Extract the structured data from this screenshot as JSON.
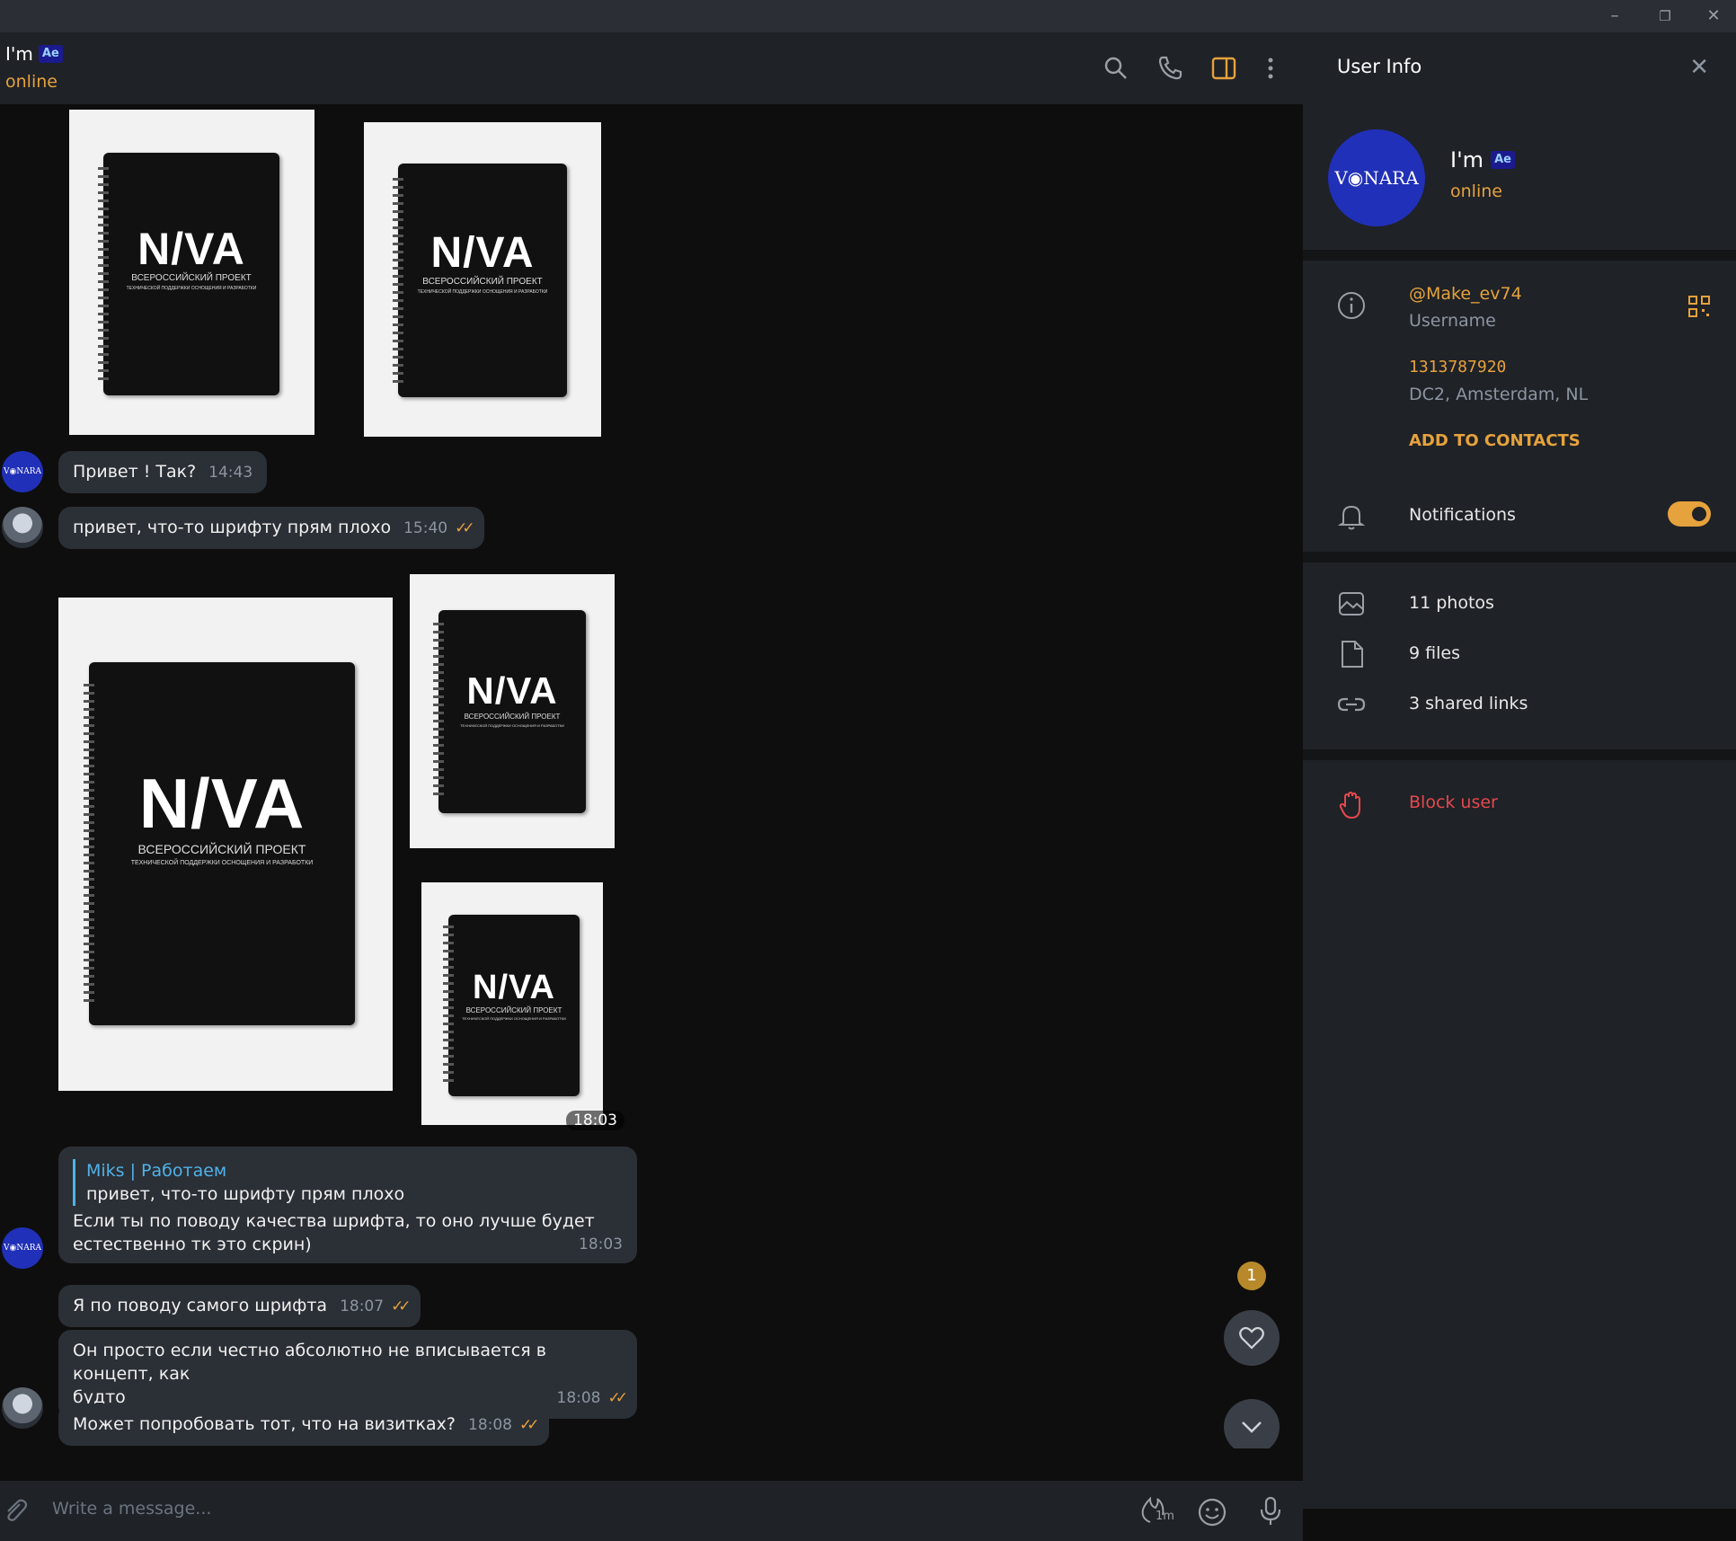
{
  "window": {
    "minimize": "–",
    "restore": "❐",
    "close": "✕"
  },
  "chat_header": {
    "name": "I'm",
    "badge": "Ae",
    "status": "online"
  },
  "messages": {
    "m1": {
      "text": "Привет ! Так?",
      "time": "14:43"
    },
    "m2": {
      "text": "привет, что-то шрифту прям плохо",
      "time": "15:40"
    },
    "album_time": "18:03",
    "m3": {
      "reply_name": "Miks | Работаем",
      "reply_text": "привет, что-то шрифту прям плохо",
      "text_line1": "Если ты по поводу качества шрифта, то оно лучше будет",
      "text_line2": "естественно тк это скрин)",
      "time": "18:03"
    },
    "m4": {
      "text": "Я по поводу самого шрифта",
      "time": "18:07"
    },
    "m5": {
      "text_line1": "Он просто если честно абсолютно не вписывается в концепт, как",
      "text_line2": "будто",
      "time": "18:08"
    },
    "m6": {
      "text": "Может попробовать тот, что на визитках?",
      "time": "18:08"
    }
  },
  "notebook": {
    "brand": "N/VA",
    "line1": "ВСЕРОССИЙСКИЙ ПРОЕКТ",
    "line2": "ТЕХНИЧЕСКОЙ ПОДДЕРЖКИ ОСНОЩЕНИЯ И РАЗРАБОТКИ"
  },
  "avatar_text": "V◉NARA",
  "reactions_badge": "1",
  "input": {
    "placeholder": "Write a message...",
    "timer_label": "1m"
  },
  "user_info": {
    "title": "User Info",
    "name": "I'm",
    "badge": "Ae",
    "status": "online",
    "username": "@Make_ev74",
    "username_label": "Username",
    "id": "1313787920",
    "dc": "DC2, Amsterdam, NL",
    "add_contacts": "ADD TO CONTACTS",
    "notifications": "Notifications",
    "photos": "11 photos",
    "files": "9 files",
    "links": "3 shared links",
    "block": "Block user"
  },
  "colors": {
    "accent": "#e6a23c",
    "link": "#4fb3e8",
    "danger": "#e5484d",
    "bubble": "#2b2f36"
  }
}
